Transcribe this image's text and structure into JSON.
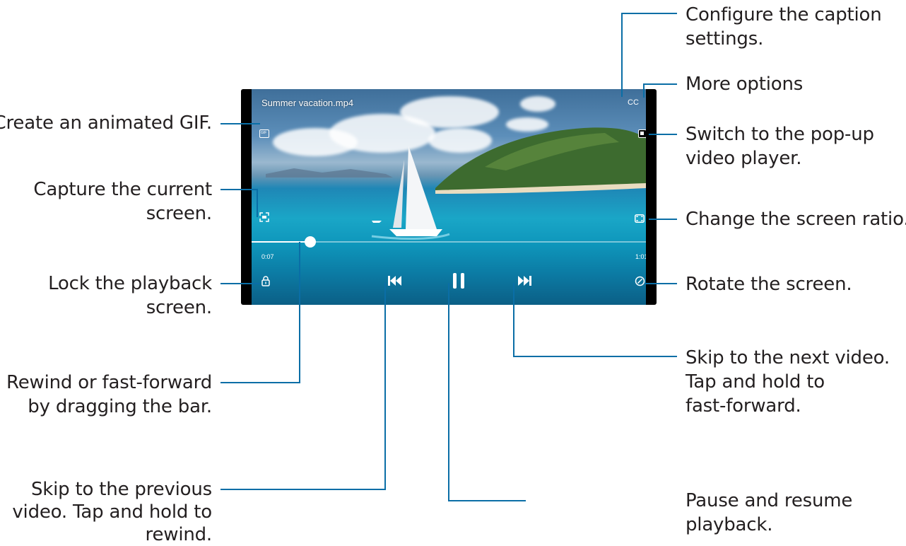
{
  "video": {
    "title": "Summer vacation.mp4",
    "elapsed": "0:07",
    "duration": "1:01",
    "progress_fraction": 0.12,
    "cc_label": "CC",
    "gif_label": "GIF"
  },
  "callouts": {
    "caption_settings": "Configure the caption\nsettings.",
    "more_options": "More options",
    "popup_player": "Switch to the pop-up\nvideo player.",
    "screen_ratio": "Change the screen ratio.",
    "rotate": "Rotate the screen.",
    "next_video": "Skip to the next video.\nTap and hold to\nfast-forward.",
    "pause_resume": "Pause and resume\nplayback.",
    "animated_gif": "Create an animated GIF.",
    "capture": "Capture the current\nscreen.",
    "lock": "Lock the playback\nscreen.",
    "drag_bar": "Rewind or fast-forward\nby dragging the bar.",
    "previous_video": "Skip to the previous\nvideo. Tap and hold to\nrewind."
  },
  "colors": {
    "leader_line": "#0a6ea6",
    "callout_text": "#231f20"
  }
}
